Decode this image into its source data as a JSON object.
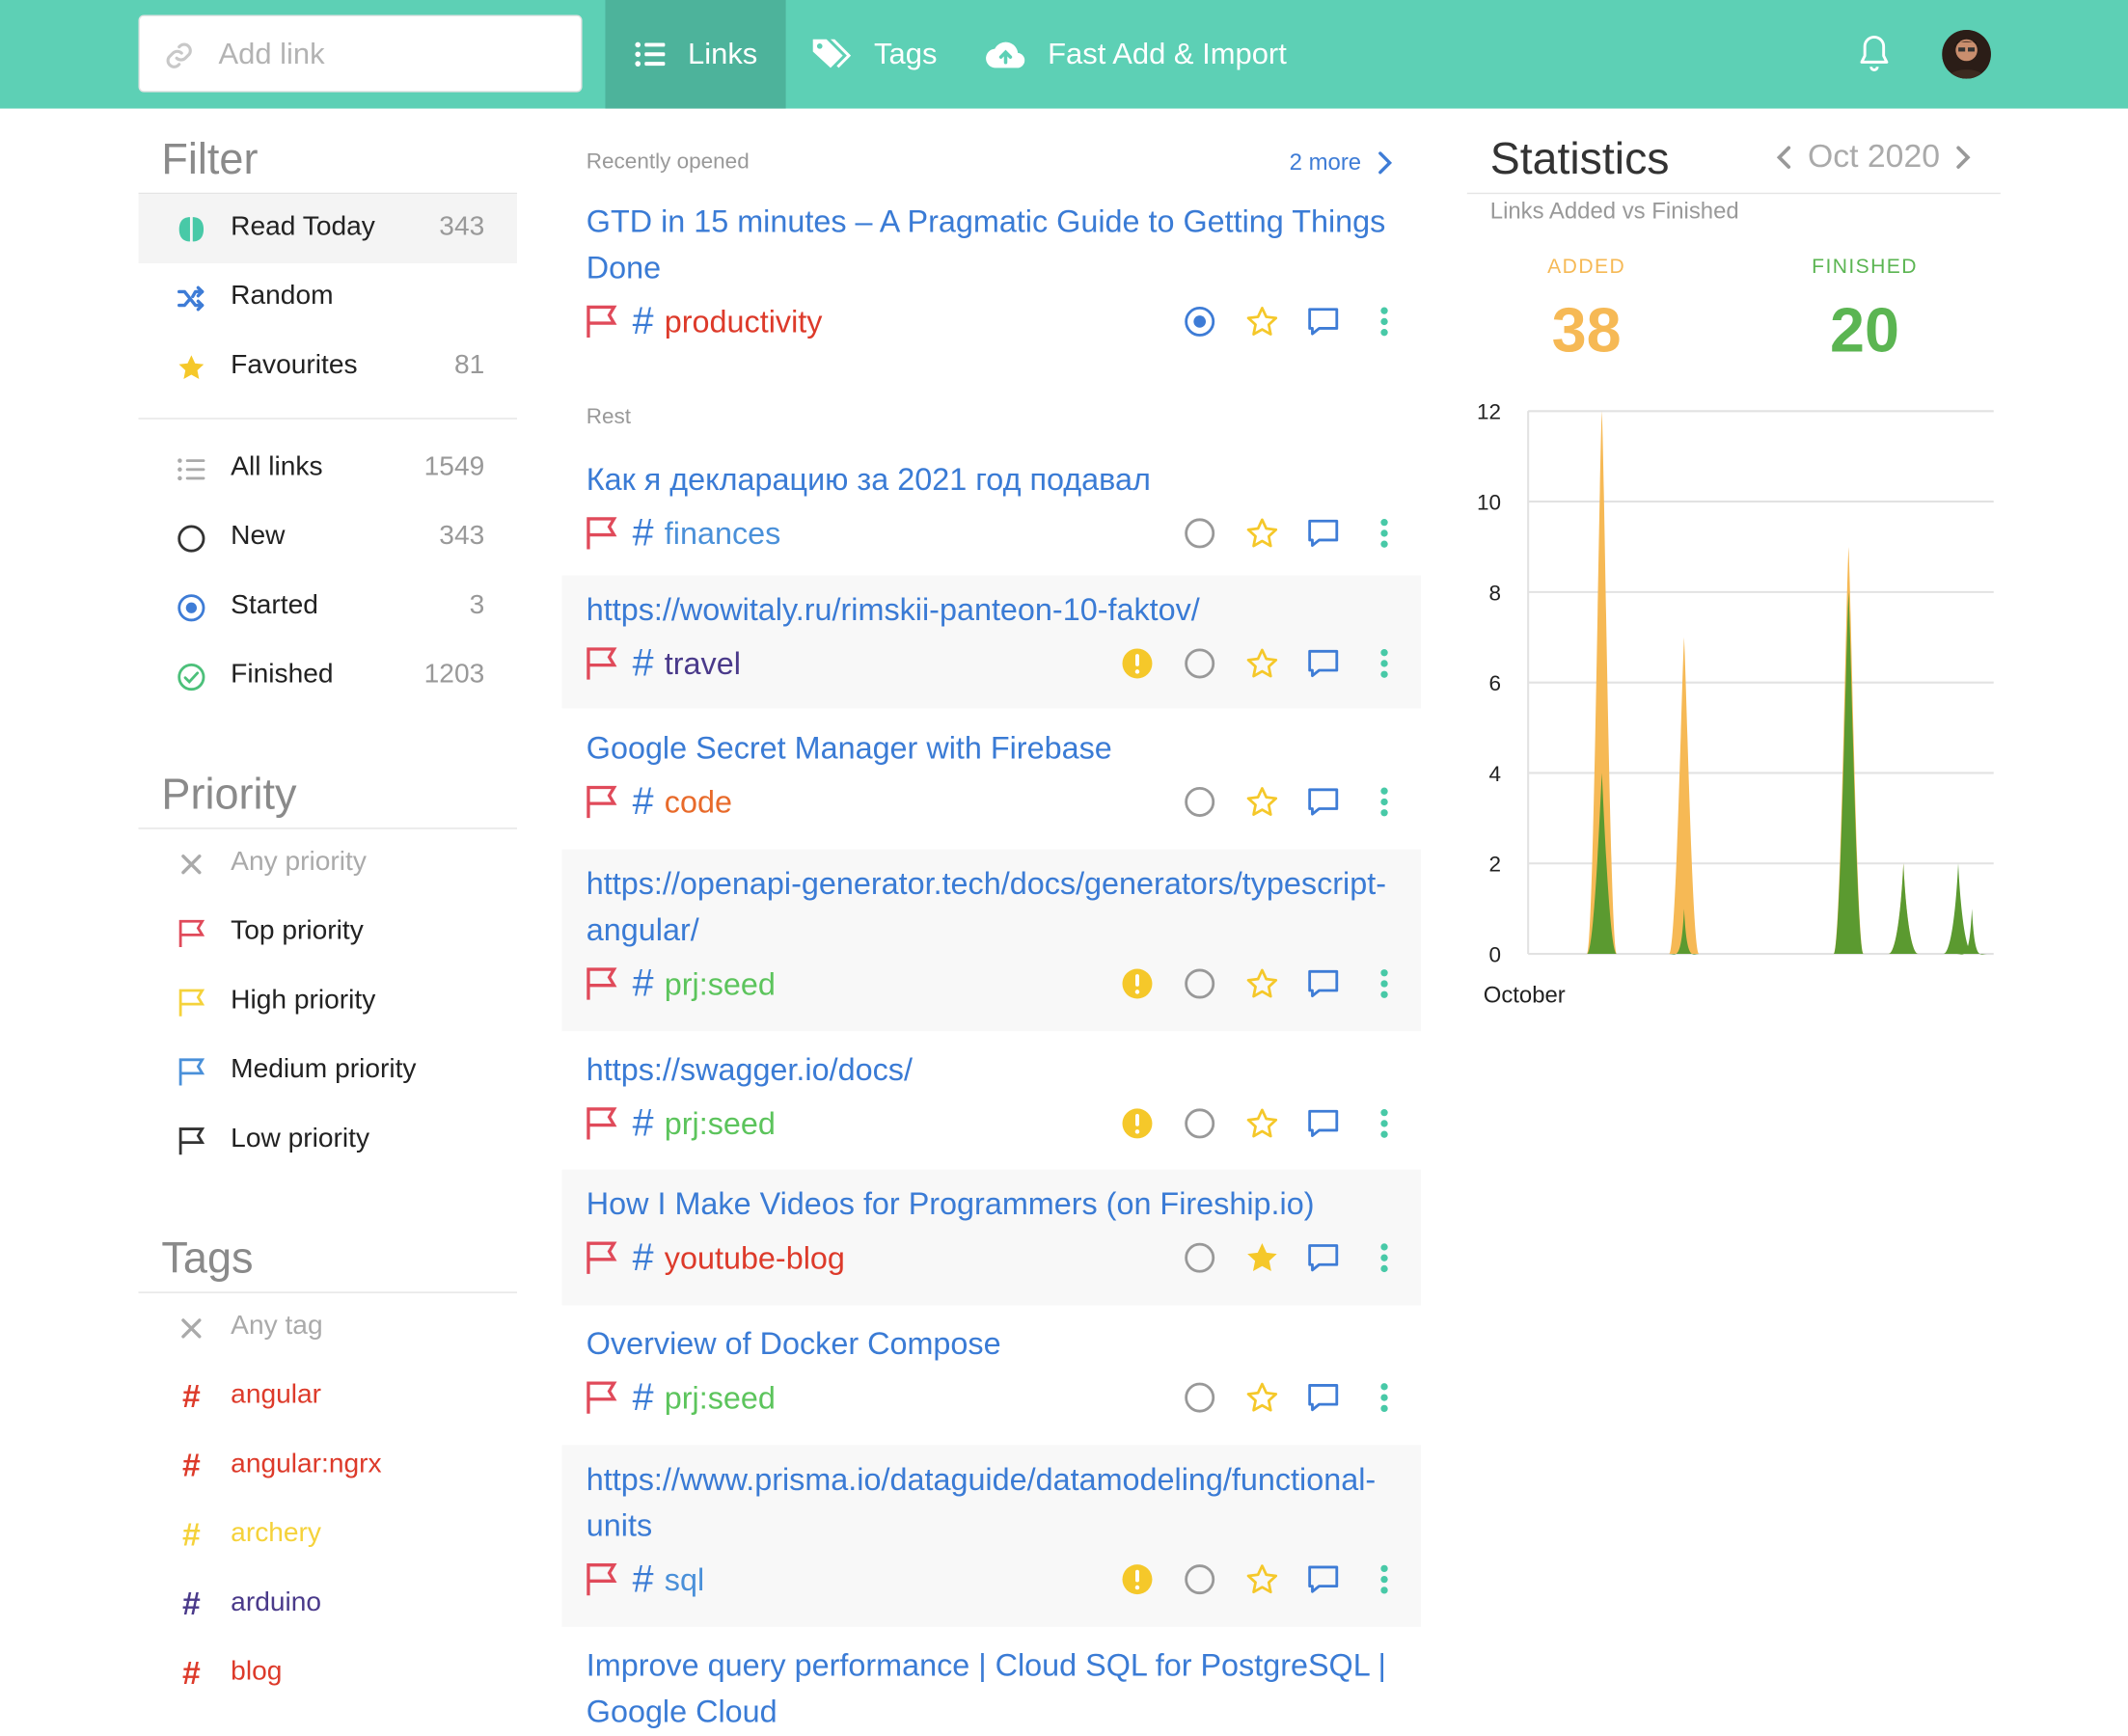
{
  "topbar": {
    "add_link_placeholder": "Add link",
    "tabs": [
      {
        "label": "Links",
        "icon": "list-icon"
      },
      {
        "label": "Tags",
        "icon": "tags-icon"
      },
      {
        "label": "Fast Add & Import",
        "icon": "cloud-upload-icon"
      }
    ],
    "accent_color": "#5dd0b5"
  },
  "filter": {
    "title": "Filter",
    "items": [
      {
        "label": "Read Today",
        "count": "343",
        "icon": "brain-icon"
      },
      {
        "label": "Random",
        "count": "",
        "icon": "shuffle-icon"
      },
      {
        "label": "Favourites",
        "count": "81",
        "icon": "star-icon"
      },
      {
        "label": "All links",
        "count": "1549",
        "icon": "list-icon"
      },
      {
        "label": "New",
        "count": "343",
        "icon": "circle-icon"
      },
      {
        "label": "Started",
        "count": "3",
        "icon": "started-icon"
      },
      {
        "label": "Finished",
        "count": "1203",
        "icon": "check-circle-icon"
      }
    ]
  },
  "priority": {
    "title": "Priority",
    "items": [
      {
        "label": "Any priority",
        "color": "#aaaaaa"
      },
      {
        "label": "Top priority",
        "color": "#e04a5a"
      },
      {
        "label": "High priority",
        "color": "#f5d23a"
      },
      {
        "label": "Medium priority",
        "color": "#4a90d9"
      },
      {
        "label": "Low priority",
        "color": "#333333"
      }
    ]
  },
  "tags": {
    "title": "Tags",
    "items": [
      {
        "label": "Any tag",
        "color": "#aaaaaa"
      },
      {
        "label": "angular",
        "color": "#dd3a2a"
      },
      {
        "label": "angular:ngrx",
        "color": "#dd3a2a"
      },
      {
        "label": "archery",
        "color": "#f5d23a"
      },
      {
        "label": "arduino",
        "color": "#4a3a8a"
      },
      {
        "label": "blog",
        "color": "#dd3a2a"
      }
    ]
  },
  "links": {
    "recent_label": "Recently opened",
    "more_label": "2 more",
    "rest_label": "Rest",
    "items": [
      {
        "title": "GTD in 15 minutes – A Pragmatic Guide to Getting Things Done",
        "tag": "productivity",
        "tag_color": "#dd3a2a",
        "status": "started",
        "favorite": false,
        "warning": false
      },
      {
        "title": "Как я декларацию за 2021 год подавал",
        "tag": "finances",
        "tag_color": "#4a90d9",
        "status": "new",
        "favorite": false,
        "warning": false
      },
      {
        "title": "https://wowitaly.ru/rimskii-panteon-10-faktov/",
        "tag": "travel",
        "tag_color": "#4a3a8a",
        "status": "new",
        "favorite": false,
        "warning": true
      },
      {
        "title": "Google Secret Manager with Firebase",
        "tag": "code",
        "tag_color": "#e86a2a",
        "status": "new",
        "favorite": false,
        "warning": false
      },
      {
        "title": "https://openapi-generator.tech/docs/generators/typescript-angular/",
        "tag": "prj:seed",
        "tag_color": "#5cc45c",
        "status": "new",
        "favorite": false,
        "warning": true
      },
      {
        "title": "https://swagger.io/docs/",
        "tag": "prj:seed",
        "tag_color": "#5cc45c",
        "status": "new",
        "favorite": false,
        "warning": true
      },
      {
        "title": "How I Make Videos for Programmers (on Fireship.io)",
        "tag": "youtube-blog",
        "tag_color": "#dd3a2a",
        "status": "new",
        "favorite": true,
        "warning": false
      },
      {
        "title": "Overview of Docker Compose",
        "tag": "prj:seed",
        "tag_color": "#5cc45c",
        "status": "new",
        "favorite": false,
        "warning": false
      },
      {
        "title": "https://www.prisma.io/dataguide/datamodeling/functional-units",
        "tag": "sql",
        "tag_color": "#4a90d9",
        "status": "new",
        "favorite": false,
        "warning": true
      },
      {
        "title": "Improve query performance  |  Cloud SQL for PostgreSQL  |  Google Cloud",
        "tag": "",
        "tag_color": "",
        "status": "",
        "favorite": false,
        "warning": false
      }
    ]
  },
  "stats": {
    "title": "Statistics",
    "month": "Oct 2020",
    "subtitle": "Links Added vs Finished",
    "added_label": "ADDED",
    "added_value": "38",
    "added_color": "#f6b955",
    "finished_label": "FINISHED",
    "finished_value": "20",
    "finished_color": "#5bb552"
  },
  "chart_data": {
    "type": "area",
    "xlabel": "October",
    "ylim": [
      0,
      12
    ],
    "yticks": [
      "0",
      "2",
      "4",
      "6",
      "8",
      "10",
      "12"
    ],
    "x": [
      1,
      2,
      3,
      4,
      5,
      6,
      7,
      8,
      9,
      10,
      11,
      12,
      13,
      14,
      15,
      16,
      17,
      18,
      19,
      20,
      21,
      22,
      23,
      24,
      25,
      26,
      27,
      28,
      29,
      30,
      31
    ],
    "series": [
      {
        "color": "#f6b955",
        "values": [
          0,
          0,
          0,
          12,
          0,
          0,
          0,
          0,
          0,
          7,
          0,
          0,
          0,
          0,
          0,
          0,
          0,
          0,
          0,
          0,
          0,
          9,
          0,
          0,
          0,
          2,
          0,
          0,
          0,
          0,
          0
        ]
      },
      {
        "color": "#5b9a30",
        "values": [
          0,
          0,
          0,
          4,
          0,
          0,
          0,
          0,
          0,
          1,
          0,
          0,
          0,
          0,
          0,
          0,
          0,
          0,
          0,
          0,
          0,
          8,
          0,
          0,
          0,
          2,
          0,
          0,
          0,
          2,
          1
        ]
      }
    ],
    "grid": true
  }
}
